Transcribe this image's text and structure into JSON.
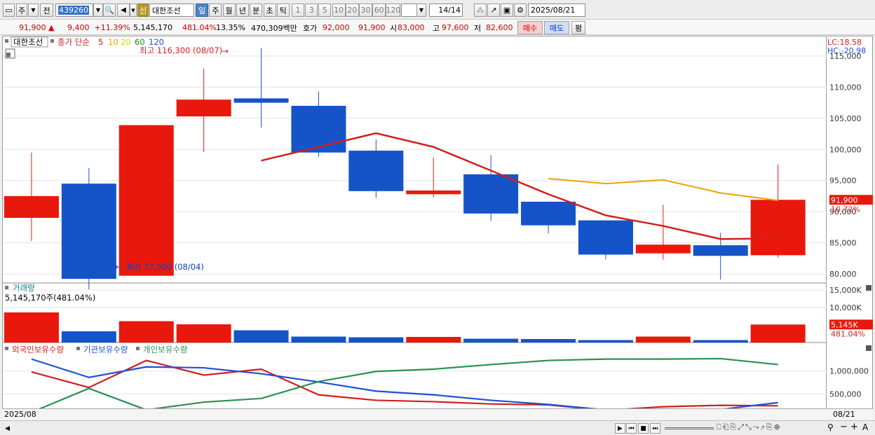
{
  "toolbar": {
    "period_label": "주",
    "prev_label": "전",
    "code": "439260",
    "stock_name": "대한조선",
    "credit_badge": "신",
    "periods": [
      "일",
      "주",
      "월",
      "년",
      "분",
      "초",
      "틱"
    ],
    "active_period": "일",
    "intervals": [
      "1",
      "3",
      "5",
      "10",
      "20",
      "30",
      "60",
      "120"
    ],
    "count": "14",
    "count_total": "/14",
    "date": "2025/08/21"
  },
  "info": {
    "price": "91,900",
    "change_arrow": "▲",
    "change": "9,400",
    "change_pct": "+11.39%",
    "volume": "5,145,170",
    "volume_ratio": "481.04%",
    "turnover": "13.35%",
    "amount": "470,309백만",
    "bid_label": "호가",
    "bid": "92,000",
    "ask": "91,900",
    "open_label": "시",
    "open": "83,000",
    "high_label": "고",
    "high": "97,600",
    "low_label": "저",
    "low": "82,600",
    "buy_label": "매수",
    "sell_label": "매도",
    "eval_label": "평"
  },
  "chart": {
    "title_tag": "대한조선",
    "ma_label": "종가 단순",
    "ma_periods": [
      "5",
      "10",
      "20",
      "60",
      "120"
    ],
    "ma_colors": [
      "#d21e1e",
      "#f0a000",
      "#d8d800",
      "#109010",
      "#2050c8"
    ],
    "high_note": "최고 116,300 (08/07)",
    "low_note": "최저 77,500 (08/04)",
    "lc_label": "LC:18.58",
    "hc_label": "HC:-20.98",
    "last_price_tag": "91,900",
    "last_pct": "10.72%",
    "y_ticks": [
      "115,000",
      "110,000",
      "105,000",
      "100,000",
      "95,000",
      "90,000",
      "85,000",
      "80,000"
    ],
    "volume_title": "거래량",
    "volume_note": "5,145,170주(481.04%)",
    "vol_ticks": [
      "15,000K",
      "10,000K"
    ],
    "vol_tag": "5,145K",
    "vol_pct": "481.04%",
    "holder_legend": [
      "외국인보유수량",
      "기관보유수량",
      "개인보유수량"
    ],
    "holder_colors": [
      "#d21e1e",
      "#2050d8",
      "#2a9050"
    ],
    "holder_ticks": [
      "1,000,000",
      "500,000"
    ],
    "date_left": "2025/08",
    "date_right": "08/21",
    "up_color": "#e8190c",
    "down_color": "#1554c8"
  },
  "chart_data": {
    "type": "candlestick",
    "candles": [
      {
        "o": 89000,
        "c": 92500,
        "h": 99500,
        "l": 85300,
        "up": true
      },
      {
        "o": 94500,
        "c": 79200,
        "h": 97000,
        "l": 77500,
        "up": false
      },
      {
        "o": 79700,
        "c": 103900,
        "h": 103900,
        "l": 79700,
        "up": true
      },
      {
        "o": 105300,
        "c": 108000,
        "h": 113000,
        "l": 99600,
        "up": true
      },
      {
        "o": 108200,
        "c": 107500,
        "h": 116300,
        "l": 103500,
        "up": false
      },
      {
        "o": 107000,
        "c": 99500,
        "h": 109300,
        "l": 98800,
        "up": false
      },
      {
        "o": 99800,
        "c": 93300,
        "h": 101600,
        "l": 92200,
        "up": false
      },
      {
        "o": 92800,
        "c": 93400,
        "h": 98700,
        "l": 92300,
        "up": true
      },
      {
        "o": 96000,
        "c": 89700,
        "h": 99100,
        "l": 88500,
        "up": false
      },
      {
        "o": 91600,
        "c": 87800,
        "h": 91600,
        "l": 86500,
        "up": false
      },
      {
        "o": 88600,
        "c": 83100,
        "h": 88600,
        "l": 82300,
        "up": false
      },
      {
        "o": 83300,
        "c": 84700,
        "h": 91100,
        "l": 82300,
        "up": true
      },
      {
        "o": 84600,
        "c": 82900,
        "h": 86600,
        "l": 79100,
        "up": false
      },
      {
        "o": 83000,
        "c": 91900,
        "h": 97600,
        "l": 82600,
        "up": true
      }
    ],
    "ma5": [
      null,
      null,
      null,
      null,
      98200,
      null,
      102600,
      100400,
      96600,
      92800,
      89400,
      87700,
      85600,
      85700
    ],
    "ma10": [
      null,
      null,
      null,
      null,
      null,
      null,
      null,
      null,
      null,
      95300,
      94500,
      95100,
      93000,
      91800
    ],
    "volume": [
      {
        "v": 8600,
        "up": true
      },
      {
        "v": 3200,
        "up": false
      },
      {
        "v": 6100,
        "up": true
      },
      {
        "v": 5200,
        "up": true
      },
      {
        "v": 3500,
        "up": false
      },
      {
        "v": 1700,
        "up": false
      },
      {
        "v": 1500,
        "up": false
      },
      {
        "v": 1600,
        "up": true
      },
      {
        "v": 1100,
        "up": false
      },
      {
        "v": 1000,
        "up": false
      },
      {
        "v": 700,
        "up": false
      },
      {
        "v": 1700,
        "up": true
      },
      {
        "v": 700,
        "up": false
      },
      {
        "v": 5145,
        "up": true
      }
    ],
    "foreign": [
      980000,
      640000,
      1230000,
      910000,
      1040000,
      480000,
      360000,
      330000,
      280000,
      260000,
      140000,
      220000,
      250000,
      240000
    ],
    "institution": [
      1260000,
      860000,
      1090000,
      1070000,
      940000,
      760000,
      560000,
      480000,
      360000,
      270000,
      150000,
      170000,
      160000,
      310000
    ],
    "individual": [
      100000,
      620000,
      150000,
      320000,
      400000,
      770000,
      990000,
      1040000,
      1140000,
      1230000,
      1260000,
      1260000,
      1270000,
      1140000
    ]
  }
}
